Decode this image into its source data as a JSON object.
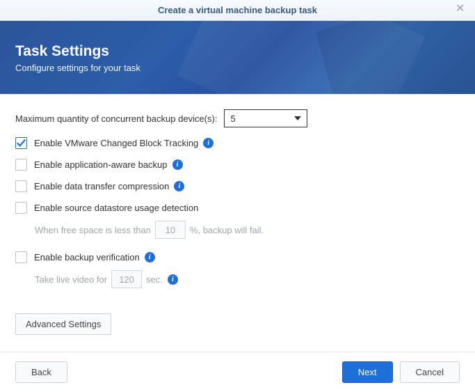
{
  "titlebar": {
    "title": "Create a virtual machine backup task"
  },
  "banner": {
    "heading": "Task Settings",
    "subheading": "Configure settings for your task"
  },
  "form": {
    "max_concurrent_label": "Maximum quantity of concurrent backup device(s):",
    "max_concurrent_value": "5",
    "cbt_label": "Enable VMware Changed Block Tracking",
    "appaware_label": "Enable application-aware backup",
    "compression_label": "Enable data transfer compression",
    "datastore_label": "Enable source datastore usage detection",
    "freespace_prefix": "When free space is less than",
    "freespace_value": "10",
    "freespace_suffix": "%, backup will fail.",
    "verification_label": "Enable backup verification",
    "livevideo_prefix": "Take live video for",
    "livevideo_value": "120",
    "livevideo_suffix": "sec.",
    "advanced_button": "Advanced Settings"
  },
  "footer": {
    "back": "Back",
    "next": "Next",
    "cancel": "Cancel"
  }
}
